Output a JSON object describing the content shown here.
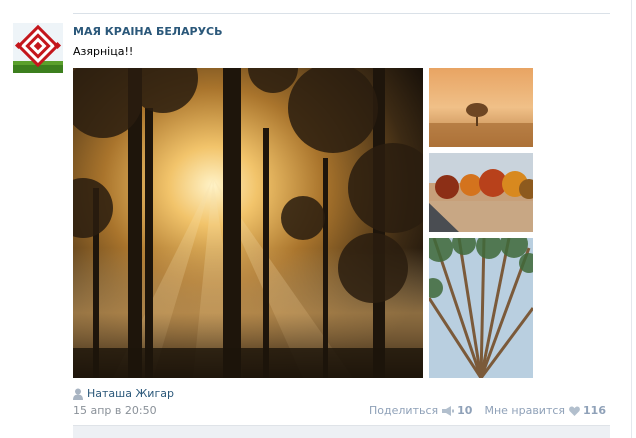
{
  "post": {
    "group_name": "МАЯ КРАІНА БЕЛАРУСЬ",
    "text": "Азярніца!!",
    "author": "Наташа Жигар",
    "timestamp": "15 апр в 20:50",
    "share_label": "Поделиться",
    "share_count": "10",
    "like_label": "Мне нравится",
    "like_count": "116"
  },
  "icons": {
    "avatar": "belarus-ornament-logo",
    "author": "user-icon",
    "share": "megaphone-icon",
    "like": "heart-icon"
  },
  "colors": {
    "link": "#2b587a",
    "muted": "#8a9199",
    "action": "#8fa1b8"
  }
}
